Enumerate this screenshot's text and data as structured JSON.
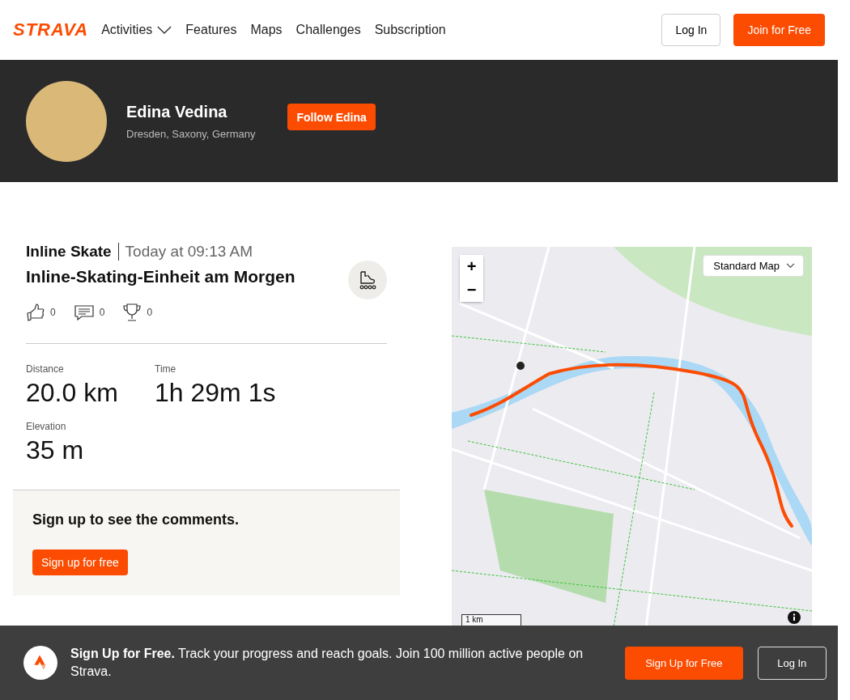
{
  "nav": {
    "logo": "STRAVA",
    "links": [
      {
        "label": "Activities",
        "dropdown": true
      },
      {
        "label": "Features",
        "dropdown": false
      },
      {
        "label": "Maps",
        "dropdown": false
      },
      {
        "label": "Challenges",
        "dropdown": false
      },
      {
        "label": "Subscription",
        "dropdown": false
      }
    ],
    "login": "Log In",
    "join": "Join for Free"
  },
  "athlete": {
    "name": "Edina Vedina",
    "location": "Dresden, Saxony, Germany",
    "follow": "Follow Edina"
  },
  "activity": {
    "type": "Inline Skate",
    "date": "Today at 09:13 AM",
    "title": "Inline-Skating-Einheit am Morgen",
    "counts": [
      {
        "kind": "kudos",
        "count": "0"
      },
      {
        "kind": "comments",
        "count": "0"
      },
      {
        "kind": "achievements",
        "count": "0"
      }
    ],
    "stats": [
      {
        "label": "Distance",
        "value": "20.0 km"
      },
      {
        "label": "Time",
        "value": "1h 29m 1s"
      },
      {
        "label": "Elevation",
        "value": "35 m"
      }
    ]
  },
  "comments": {
    "prompt": "Sign up to see the comments.",
    "button": "Sign up for free"
  },
  "map": {
    "style": "Standard Map",
    "zoom_in": "+",
    "zoom_out": "−",
    "scale": "1 km"
  },
  "banner": {
    "text": "**Sign Up for Free.** Track your progress and reach goals. Join 100 million active people on Strava.",
    "signup": "Sign Up for Free",
    "login": "Log In"
  }
}
